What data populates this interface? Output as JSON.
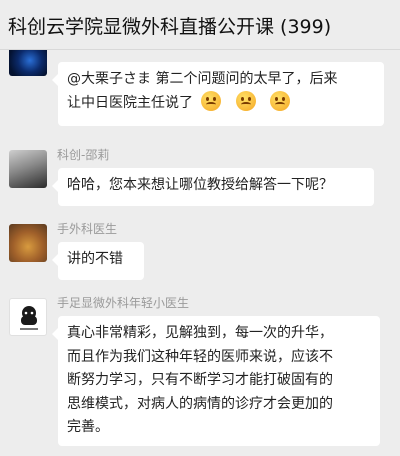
{
  "header": {
    "title": "科创云学院显微外科直播公开课 (399)"
  },
  "messages": [
    {
      "sender": "",
      "text_line1": "@大栗子さま 第二个问题问的太早了，后来",
      "text_line2": "让中日医院主任说了"
    },
    {
      "sender": "科创-邵莉",
      "text": "哈哈，您本来想让哪位教授给解答一下呢？"
    },
    {
      "sender": "手外科医生",
      "text": "讲的不错"
    },
    {
      "sender": "手足显微外科年轻小医生",
      "lines": [
        "真心非常精彩，见解独到，每一次的升华，",
        "而且作为我们这种年轻的医师来说，应该不",
        "断努力学习，只有不断学习才能打破固有的",
        "思维模式，对病人的病情的诊疗才会更加的",
        "完善。"
      ]
    }
  ],
  "colors": {
    "background": "#ededed",
    "bubble": "#ffffff",
    "sender": "#9a9a9a"
  }
}
